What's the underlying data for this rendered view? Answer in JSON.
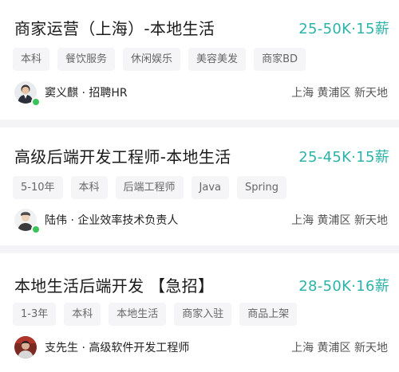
{
  "colors": {
    "salary": "#2cb3a8",
    "online": "#39c45a",
    "page_background": "#f4f4f6"
  },
  "jobs": [
    {
      "title": "商家运营（上海）-本地生活",
      "salary": "25-50K·15薪",
      "tags": [
        "本科",
        "餐饮服务",
        "休闲娱乐",
        "美容美发",
        "商家BD"
      ],
      "recruiter": "窦义麒 · 招聘HR",
      "location": "上海 黄浦区 新天地",
      "online": true
    },
    {
      "title": "高级后端开发工程师-本地生活",
      "salary": "25-45K·15薪",
      "tags": [
        "5-10年",
        "本科",
        "后端工程师",
        "Java",
        "Spring"
      ],
      "recruiter": "陆伟 · 企业效率技术负责人",
      "location": "上海 黄浦区 新天地",
      "online": true
    },
    {
      "title": "本地生活后端开发 【急招】",
      "salary": "28-50K·16薪",
      "tags": [
        "1-3年",
        "本科",
        "本地生活",
        "商家入驻",
        "商品上架"
      ],
      "recruiter": "支先生 · 高级软件开发工程师",
      "location": "上海 黄浦区 新天地",
      "online": false
    }
  ]
}
